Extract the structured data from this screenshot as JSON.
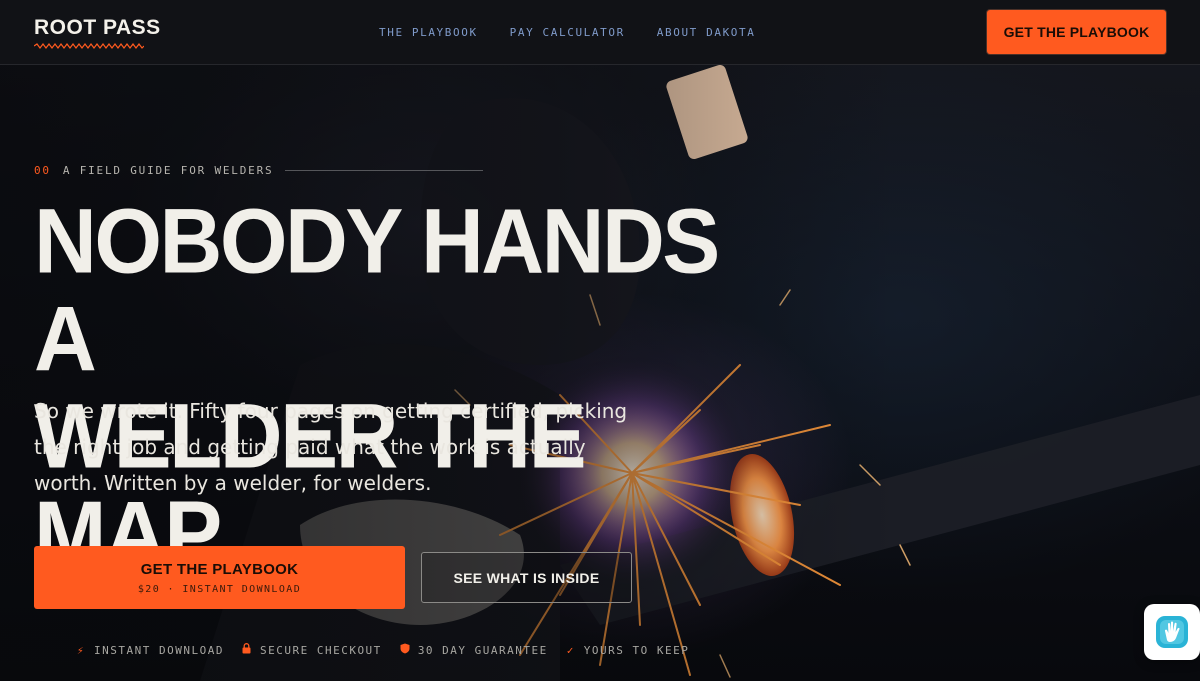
{
  "brand": {
    "name": "ROOT PASS",
    "accent": "#ff5a1f"
  },
  "nav": {
    "links": [
      "THE PLAYBOOK",
      "PAY CALCULATOR",
      "ABOUT DAKOTA"
    ],
    "cta_label": "GET THE PLAYBOOK"
  },
  "hero": {
    "eyebrow_number": "00",
    "eyebrow_text": "A FIELD GUIDE FOR WELDERS",
    "headline_line1": "NOBODY HANDS A",
    "headline_line2": "WELDER THE MAP.",
    "lede": "So we wrote it. Fifty four pages on getting certified, picking the right job and getting paid what the work is actually worth. Written by a welder, for welders.",
    "cta_primary_label": "GET THE PLAYBOOK",
    "cta_primary_sub": "$20 · INSTANT DOWNLOAD",
    "cta_secondary_label": "SEE WHAT IS INSIDE"
  },
  "trust": [
    {
      "icon": "lightning-icon",
      "label": "INSTANT DOWNLOAD"
    },
    {
      "icon": "lock-icon",
      "label": "SECURE CHECKOUT"
    },
    {
      "icon": "shield-icon",
      "label": "30 DAY GUARANTEE"
    },
    {
      "icon": "check-icon",
      "label": "YOURS TO KEEP"
    }
  ],
  "widget": {
    "icon": "hand-icon"
  }
}
